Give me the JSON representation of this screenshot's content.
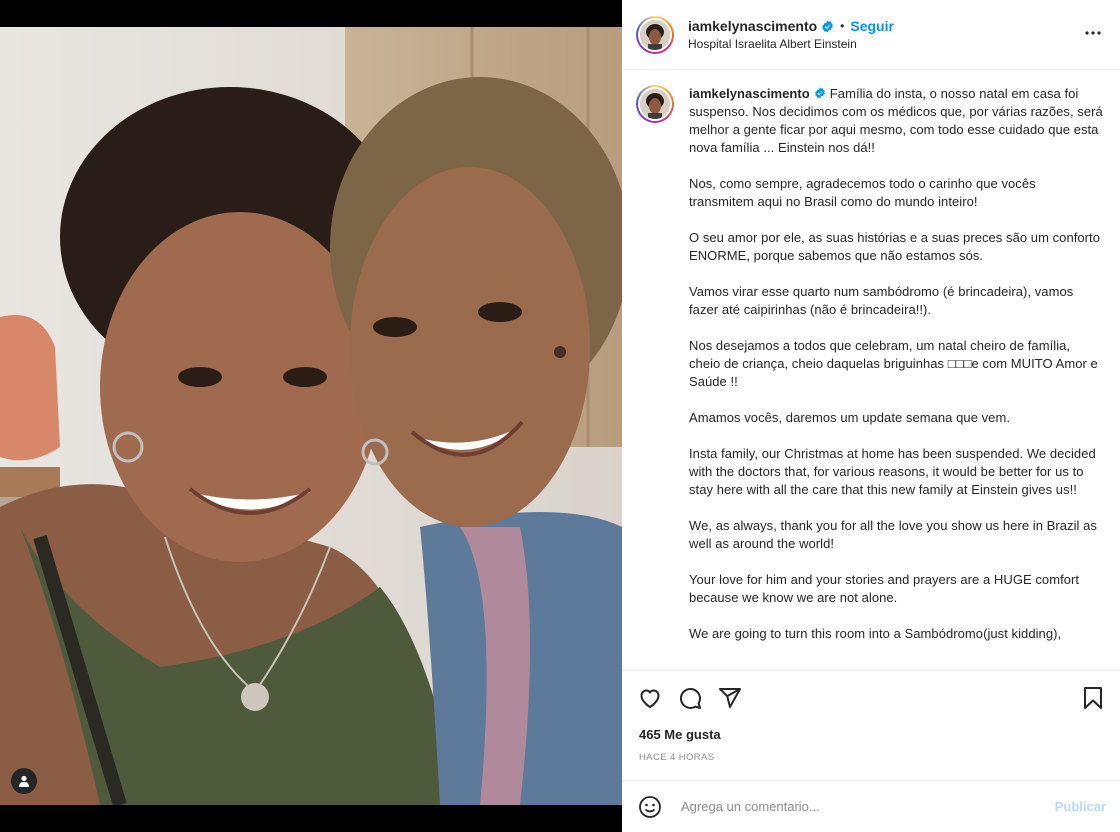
{
  "post": {
    "username": "iamkelynascimento",
    "follow_label": "Seguir",
    "location": "Hospital Israelita Albert Einstein",
    "caption": "Família do insta, o nosso natal em casa foi suspenso. Nos decidimos com os médicos que, por várias razões, será melhor a gente ficar por aqui mesmo, com todo esse cuidado que esta nova família ... Einstein nos dá!!\n\nNos, como sempre, agradecemos todo o carinho que vocês transmitem aqui no Brasil como do mundo inteiro!\n\nO seu amor por ele, as suas histórias e a suas preces são um conforto ENORME, porque sabemos que não estamos sós.\n\nVamos virar esse quarto num sambódromo (é brincadeira), vamos fazer até caipirinhas (não é brincadeira!!).\n\nNos desejamos a todos que celebram, um natal cheiro de família, cheio de criança, cheio daquelas briguinhas □□□e com MUITO Amor e Saúde !!\n\nAmamos vocês, daremos um update semana que vem.\n\nInsta family, our Christmas at home has been suspended. We decided with the doctors that, for various reasons, it would be better for us to stay here with all the care that this new family at Einstein gives us!!\n\nWe, as always, thank you for all the love you show us here in Brazil as well as around the world!\n\nYour love for him and your stories and prayers are a HUGE comfort because we know we are not alone.\n\nWe are going to turn this room into a Sambódromo(just kidding),",
    "likes": "465 Me gusta",
    "time": "HACE 4 HORAS",
    "comment_placeholder": "Agrega un comentario...",
    "publish_label": "Publicar"
  },
  "colors": {
    "accent": "#0095f6",
    "verified": "#0095f6",
    "publish_disabled": "#b3dbff"
  },
  "icons": [
    "verified-badge-icon",
    "more-options-icon",
    "heart-icon",
    "comment-icon",
    "share-icon",
    "bookmark-icon",
    "emoji-icon",
    "user-tag-icon"
  ]
}
